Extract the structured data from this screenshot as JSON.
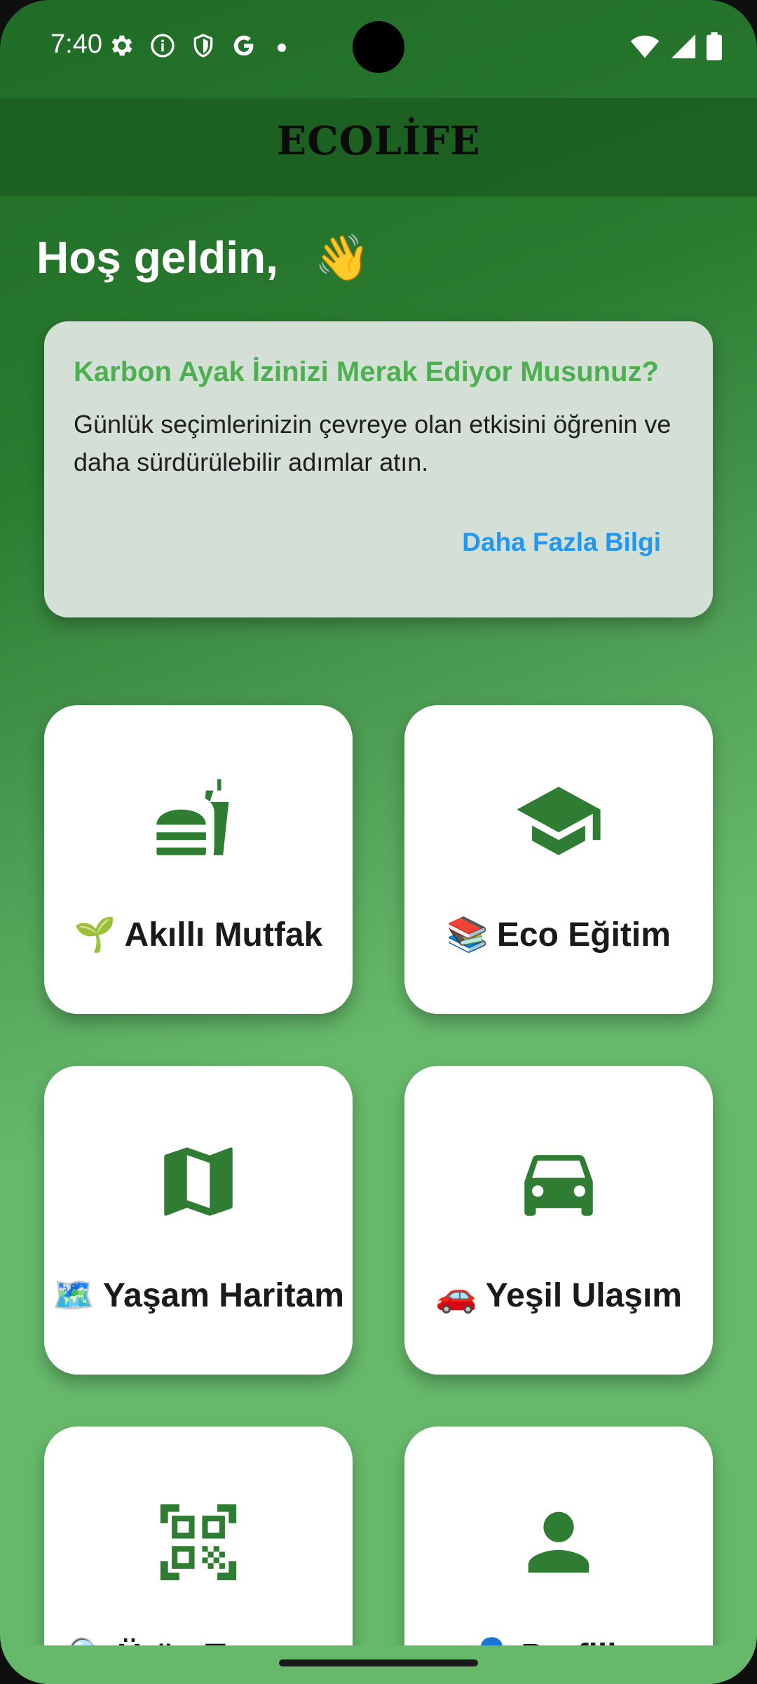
{
  "status_bar": {
    "time": "7:40",
    "left_icons": [
      "settings-icon",
      "info-icon",
      "shield-icon",
      "google-icon",
      "dot-icon"
    ],
    "right_icons": [
      "wifi-icon",
      "signal-icon",
      "battery-icon"
    ]
  },
  "app_bar": {
    "title": "ECOLİFE"
  },
  "greeting": {
    "text": "Hoş geldin,",
    "emoji": "👋"
  },
  "info_card": {
    "title": "Karbon Ayak İzinizi Merak Ediyor Musunuz?",
    "body": "Günlük seçimlerinizin çevreye olan etkisini öğrenin ve daha sürdürülebilir adımlar atın.",
    "link": "Daha Fazla Bilgi"
  },
  "tiles": [
    {
      "emoji": "🌱",
      "label": "Akıllı Mutfak",
      "icon": "fastfood-icon"
    },
    {
      "emoji": "📚",
      "label": "Eco Eğitim",
      "icon": "school-icon"
    },
    {
      "emoji": "🗺️",
      "label": "Yaşam Haritam",
      "icon": "map-icon"
    },
    {
      "emoji": "🚗",
      "label": "Yeşil Ulaşım",
      "icon": "car-icon"
    },
    {
      "emoji": "🔍",
      "label": "Ürün Tarayıcı",
      "icon": "qr-scanner-icon"
    },
    {
      "emoji": "👤",
      "label": "Profilim",
      "icon": "person-icon"
    }
  ],
  "colors": {
    "primary_green": "#2e7d32",
    "accent_green": "#4caf50",
    "link_blue": "#2196f3",
    "card_bg": "#d4e0d5"
  }
}
